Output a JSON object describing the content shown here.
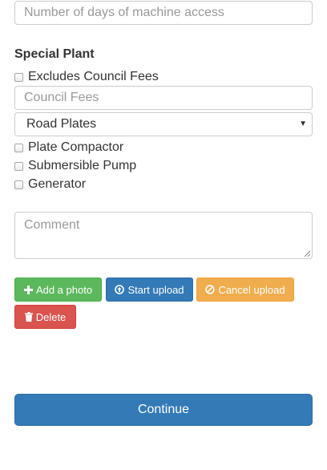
{
  "days_input": {
    "placeholder": "Number of days of machine access"
  },
  "special_plant": {
    "heading": "Special Plant",
    "excludes_council_fees_label": "Excludes Council Fees",
    "council_fees_placeholder": "Council Fees",
    "plate_select_value": "Road Plates",
    "options": {
      "plate_compactor": "Plate Compactor",
      "submersible_pump": "Submersible Pump",
      "generator": "Generator"
    }
  },
  "comment": {
    "placeholder": "Comment"
  },
  "upload_buttons": {
    "add_photo": "Add a photo",
    "start_upload": "Start upload",
    "cancel_upload": "Cancel upload",
    "delete": "Delete"
  },
  "continue_button": "Continue",
  "colors": {
    "success": "#5cb85c",
    "primary": "#337ab7",
    "warning": "#f0ad4e",
    "danger": "#d9534f"
  },
  "icons": {
    "add_photo": "plus-icon",
    "start_upload": "upload-circle-icon",
    "cancel_upload": "ban-icon",
    "delete": "trash-icon"
  }
}
